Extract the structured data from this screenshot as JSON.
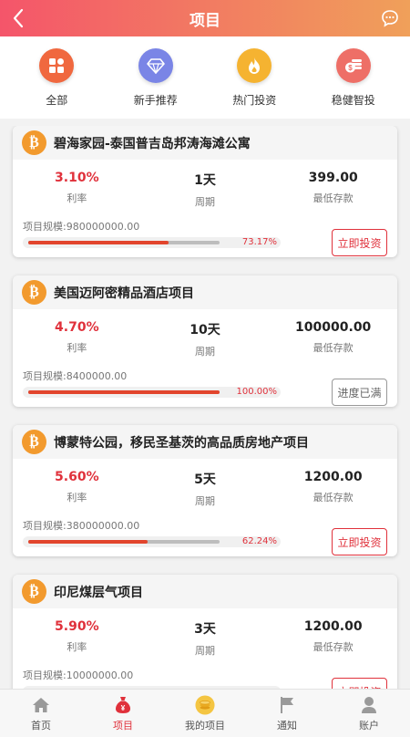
{
  "header": {
    "title": "项目"
  },
  "categories": [
    {
      "label": "全部",
      "color": "#f0683f",
      "icon": "grid-icon"
    },
    {
      "label": "新手推荐",
      "color": "#7a85e6",
      "icon": "diamond-icon"
    },
    {
      "label": "热门投资",
      "color": "#f5b331",
      "icon": "flame-icon"
    },
    {
      "label": "稳健智投",
      "color": "#ee6f67",
      "icon": "coins-icon"
    }
  ],
  "projects": [
    {
      "title": "碧海家园-泰国普吉岛邦涛海滩公寓",
      "rate": "3.10%",
      "rate_label": "利率",
      "period": "1天",
      "period_label": "周期",
      "min": "399.00",
      "min_label": "最低存款",
      "scale": "项目规模:980000000.00",
      "progress": 0.7317,
      "progress_text": "73.17%",
      "button": "立即投资",
      "button_state": "active"
    },
    {
      "title": "美国迈阿密精品酒店项目",
      "rate": "4.70%",
      "rate_label": "利率",
      "period": "10天",
      "period_label": "周期",
      "min": "100000.00",
      "min_label": "最低存款",
      "scale": "项目规模:8400000.00",
      "progress": 1.0,
      "progress_text": "100.00%",
      "button": "进度已满",
      "button_state": "done"
    },
    {
      "title": "博蒙特公园，移民圣基茨的高品质房地产项目",
      "rate": "5.60%",
      "rate_label": "利率",
      "period": "5天",
      "period_label": "周期",
      "min": "1200.00",
      "min_label": "最低存款",
      "scale": "项目规模:380000000.00",
      "progress": 0.6224,
      "progress_text": "62.24%",
      "button": "立即投资",
      "button_state": "active"
    },
    {
      "title": "印尼煤层气项目",
      "rate": "5.90%",
      "rate_label": "利率",
      "period": "3天",
      "period_label": "周期",
      "min": "1200.00",
      "min_label": "最低存款",
      "scale": "项目规模:10000000.00",
      "progress": 0.81,
      "progress_text": "",
      "button": "立即投资",
      "button_state": "active"
    }
  ],
  "tabbar": [
    {
      "label": "首页",
      "icon": "home-icon",
      "active": false
    },
    {
      "label": "项目",
      "icon": "money-bag-icon",
      "active": true
    },
    {
      "label": "我的项目",
      "icon": "coin-stack-icon",
      "active": false
    },
    {
      "label": "通知",
      "icon": "flag-icon",
      "active": false
    },
    {
      "label": "账户",
      "icon": "user-icon",
      "active": false
    }
  ],
  "colors": {
    "accent": "#e0313b",
    "header_start": "#f4556a",
    "header_end": "#f0a05a",
    "bitcoin": "#f29a2e"
  }
}
